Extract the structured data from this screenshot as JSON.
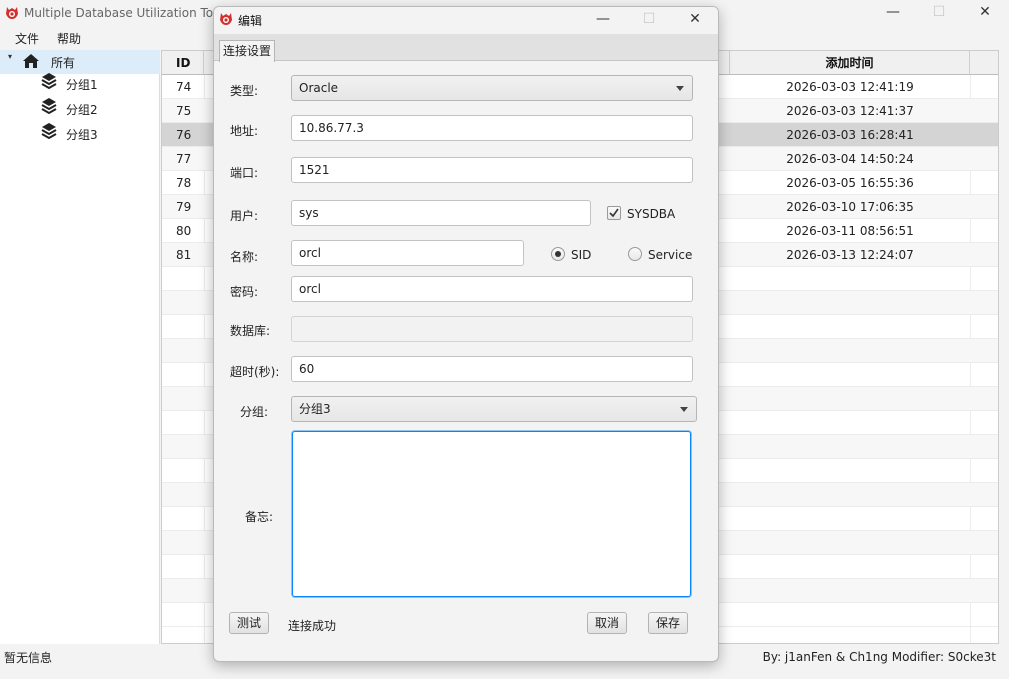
{
  "app": {
    "title": "Multiple Database Utilization Tools",
    "minimize_glyph": "—",
    "maximize_glyph": "☐",
    "close_glyph": "✕"
  },
  "menu": {
    "file": "文件",
    "help": "帮助"
  },
  "tree": {
    "root": {
      "label": "所有",
      "icon": "home-icon",
      "expander": "▾"
    },
    "children": [
      {
        "label": "分组1",
        "icon": "layers-icon"
      },
      {
        "label": "分组2",
        "icon": "layers-icon"
      },
      {
        "label": "分组3",
        "icon": "layers-icon"
      }
    ]
  },
  "table": {
    "columns": {
      "id": "ID",
      "added_time": "添加时间"
    },
    "rows": [
      {
        "id": "74",
        "time": "2026-03-03 12:41:19"
      },
      {
        "id": "75",
        "time": "2026-03-03 12:41:37"
      },
      {
        "id": "76",
        "time": "2026-03-03 16:28:41",
        "selected": true
      },
      {
        "id": "77",
        "time": "2026-03-04 14:50:24"
      },
      {
        "id": "78",
        "time": "2026-03-05 16:55:36"
      },
      {
        "id": "79",
        "time": "2026-03-10 17:06:35"
      },
      {
        "id": "80",
        "time": "2026-03-11 08:56:51"
      },
      {
        "id": "81",
        "time": "2026-03-13 12:24:07"
      }
    ]
  },
  "status": {
    "left": "暂无信息",
    "right": "By: j1anFen & Ch1ng Modifier: S0cke3t"
  },
  "dialog": {
    "title": "编辑",
    "tab": "连接设置",
    "type": {
      "label": "类型:",
      "value": "Oracle"
    },
    "address": {
      "label": "地址:",
      "value": "10.86.77.3"
    },
    "port": {
      "label": "端口:",
      "value": "1521"
    },
    "user": {
      "label": "用户:",
      "value": "sys"
    },
    "sysdba": {
      "label": "SYSDBA",
      "checked": true
    },
    "name": {
      "label": "名称:",
      "value": "orcl"
    },
    "sid": {
      "label": "SID",
      "selected": true
    },
    "service": {
      "label": "Service",
      "selected": false
    },
    "password": {
      "label": "密码:",
      "value": "orcl"
    },
    "database": {
      "label": "数据库:",
      "value": ""
    },
    "timeout": {
      "label": "超时(秒):",
      "value": "60"
    },
    "group": {
      "label": "分组:",
      "value": "分组3"
    },
    "notes": {
      "label": "备忘:",
      "value": ""
    },
    "test_button": "测试",
    "test_result": "连接成功",
    "cancel_button": "取消",
    "save_button": "保存"
  },
  "colors": {
    "accent": "#0a84ff",
    "selected_row": "#d4d4d4",
    "logo_red": "#d32f2f"
  }
}
